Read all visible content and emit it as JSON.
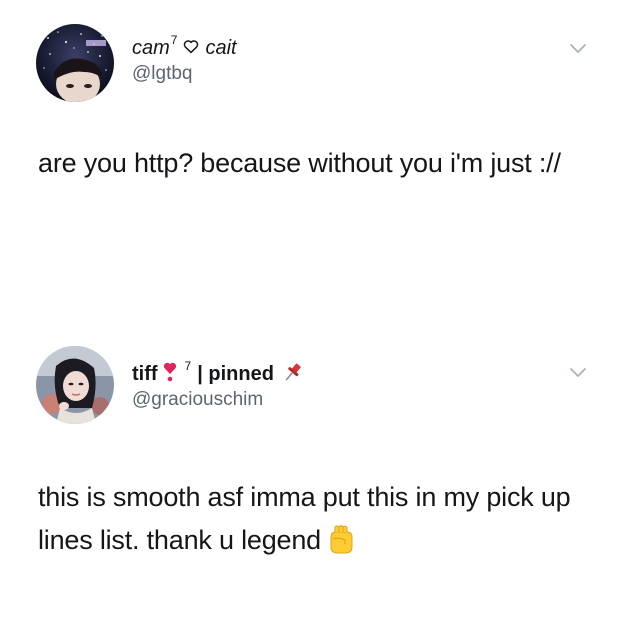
{
  "tweets": [
    {
      "display_name_part1": "cam",
      "display_name_sup": "7",
      "display_name_part2": "cait",
      "handle": "@lgtbq",
      "text": "are you http? because without you i'm just ://",
      "avatar_icon": "avatar-photo",
      "menu_icon": "chevron-down-icon"
    },
    {
      "display_name_part1": "tiff",
      "display_name_sup": "7",
      "display_name_part2": "| pinned",
      "handle": "@graciouschim",
      "text": "this is smooth asf imma put this in my pick up lines list. thank u legend",
      "avatar_icon": "avatar-photo",
      "menu_icon": "chevron-down-icon",
      "emoji_icons": [
        "heart-exclamation-icon",
        "pushpin-icon",
        "raised-fist-icon"
      ]
    }
  ],
  "colors": {
    "text": "#14171a",
    "handle": "#5b6670",
    "chevron": "#a9b3bc",
    "heart_red": "#e0245e",
    "fist_yellow": "#ffcc33"
  }
}
